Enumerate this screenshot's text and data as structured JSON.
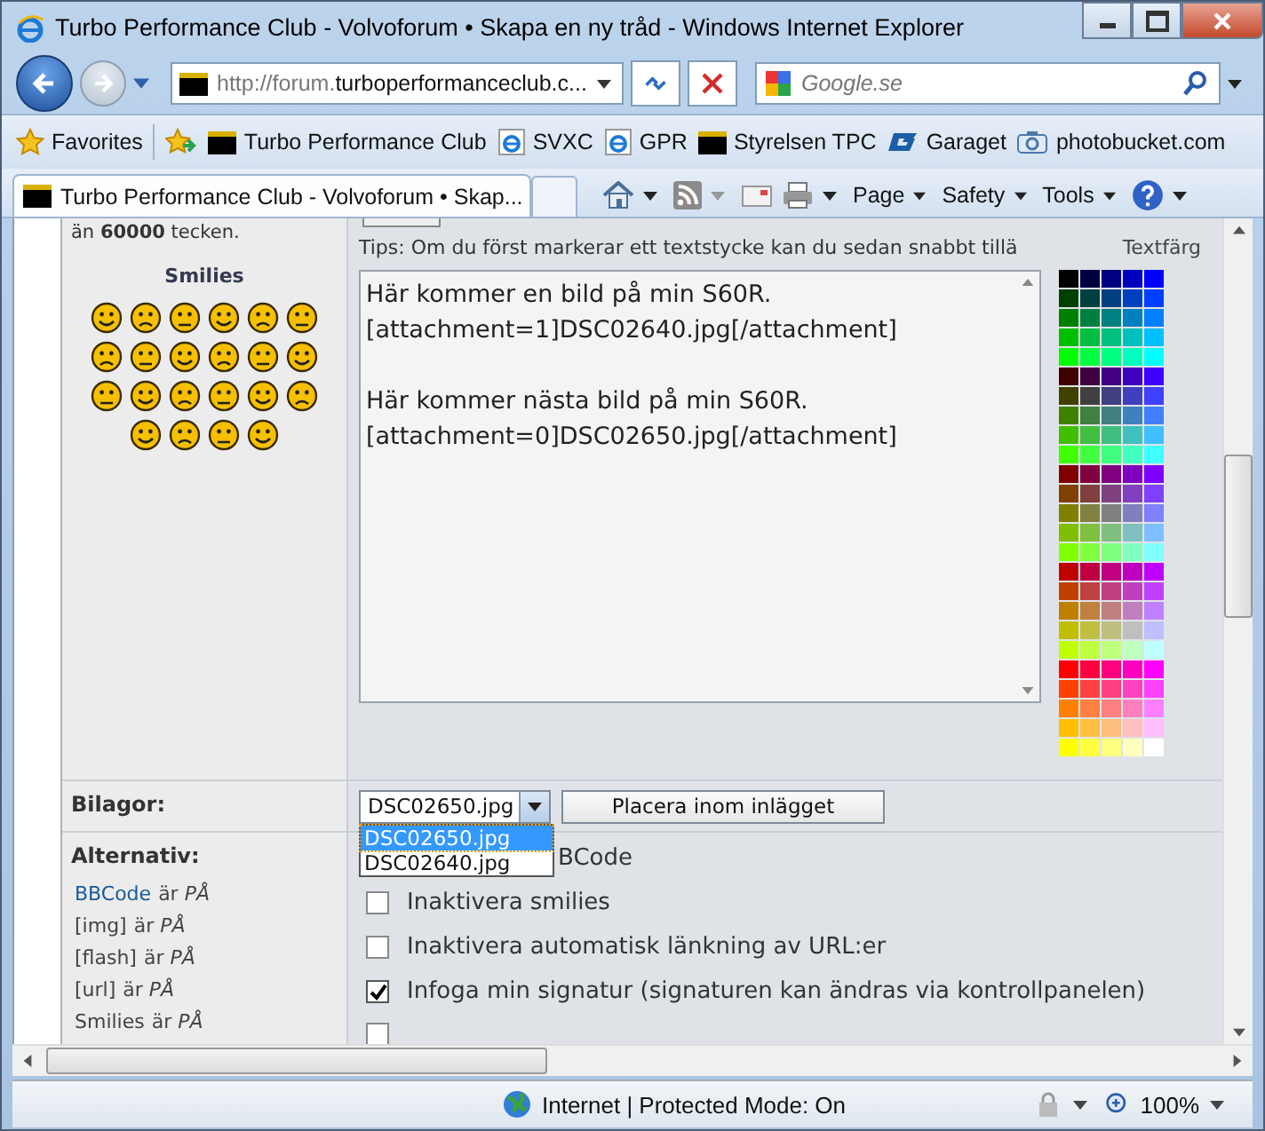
{
  "window": {
    "title": "Turbo Performance Club - Volvoforum • Skapa en ny tråd - Windows Internet Explorer"
  },
  "address_bar": {
    "url_prefix": "http://forum.",
    "url_rest": "turboperformanceclub.c..."
  },
  "search": {
    "placeholder": "Google.se"
  },
  "favorites_bar": {
    "label": "Favorites",
    "links": [
      {
        "label": "Turbo Performance Club"
      },
      {
        "label": "SVXC"
      },
      {
        "label": "GPR"
      },
      {
        "label": "Styrelsen TPC"
      },
      {
        "label": "Garaget"
      },
      {
        "label": "photobucket.com"
      }
    ]
  },
  "tabs": [
    {
      "label": "Turbo Performance Club - Volvoforum • Skap...",
      "selected": true
    }
  ],
  "command_bar": [
    "Page",
    "Safety",
    "Tools"
  ],
  "form": {
    "limit_text": "än **60000** tecken.",
    "smilies_title": "Smilies",
    "tips": "Tips: Om du först markerar ett textstycke kan du sedan snabbt tillä",
    "color_label": "Textfärg",
    "message": "Här kommer en bild på min S60R.\n[attachment=1]DSC02640.jpg[/attachment]\n\nHär kommer nästa bild på min S60R.\n[attachment=0]DSC02650.jpg[/attachment]",
    "attachments_label": "Bilagor:",
    "attachment_select": {
      "value": "DSC02650.jpg",
      "options": [
        {
          "label": "DSC02650.jpg",
          "selected": true
        },
        {
          "label": "DSC02640.jpg",
          "selected": false
        }
      ]
    },
    "place_button": "Placera inom inlägget",
    "options_label": "Alternativ:",
    "option_notes": [
      {
        "kind": "link",
        "tag": "BBCode",
        "rest": "är",
        "state": "PÅ"
      },
      {
        "kind": "text",
        "tag": "[img]",
        "rest": "är",
        "state": "PÅ"
      },
      {
        "kind": "text",
        "tag": "[flash]",
        "rest": "är",
        "state": "PÅ"
      },
      {
        "kind": "text",
        "tag": "[url]",
        "rest": "är",
        "state": "PÅ"
      },
      {
        "kind": "text",
        "tag": "Smilies",
        "rest": "är",
        "state": "PÅ"
      }
    ],
    "checkboxes": [
      {
        "kind": "covered",
        "label": "BCode"
      },
      {
        "kind": "checkbox",
        "label": "Inaktivera smilies",
        "checked": false
      },
      {
        "kind": "checkbox",
        "label": "Inaktivera automatisk länkning av URL:er",
        "checked": false
      },
      {
        "kind": "checkbox",
        "label": "Infoga min signatur (signaturen kan ändras via kontrollpanelen)",
        "checked": true
      },
      {
        "kind": "cut",
        "checked": false
      }
    ]
  },
  "status_bar": {
    "zone": "Internet | Protected Mode: On",
    "zoom": "100%"
  }
}
